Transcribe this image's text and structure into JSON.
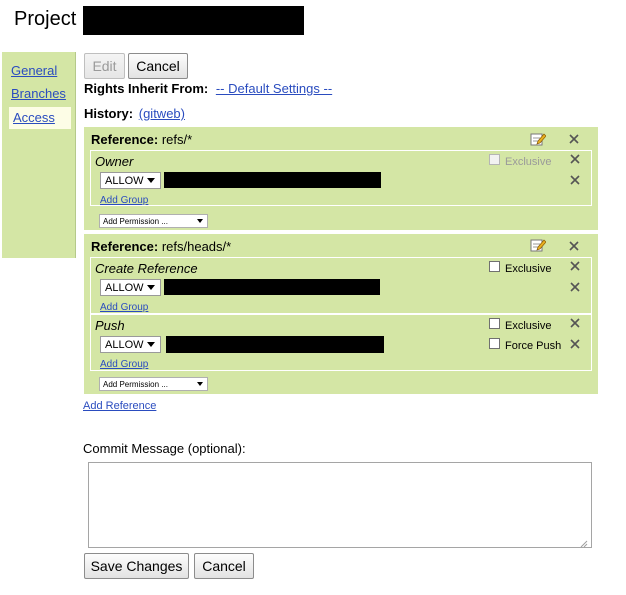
{
  "header": {
    "title": "Project"
  },
  "sidebar": {
    "items": [
      {
        "label": "General"
      },
      {
        "label": "Branches"
      },
      {
        "label": "Access"
      }
    ]
  },
  "toolbar": {
    "edit_label": "Edit",
    "cancel_label": "Cancel"
  },
  "inherit": {
    "label": "Rights Inherit From:",
    "value": "-- Default Settings --"
  },
  "history": {
    "label": "History:",
    "link": "(gitweb)"
  },
  "sections": [
    {
      "ref_label": "Reference:",
      "ref": "refs/*",
      "permissions": [
        {
          "name": "Owner",
          "exclusive_label": "Exclusive",
          "rule_action": "ALLOW",
          "add_group": "Add Group"
        }
      ],
      "add_permission": "Add Permission ..."
    },
    {
      "ref_label": "Reference:",
      "ref": "refs/heads/*",
      "permissions": [
        {
          "name": "Create Reference",
          "exclusive_label": "Exclusive",
          "rule_action": "ALLOW",
          "add_group": "Add Group"
        },
        {
          "name": "Push",
          "exclusive_label": "Exclusive",
          "force_push_label": "Force Push",
          "rule_action": "ALLOW",
          "add_group": "Add Group"
        }
      ],
      "add_permission": "Add Permission ..."
    }
  ],
  "add_reference": "Add Reference",
  "commit": {
    "label": "Commit Message (optional):",
    "value": ""
  },
  "footer": {
    "save_label": "Save Changes",
    "cancel_label": "Cancel"
  },
  "icons": {
    "edit": "edit-icon",
    "remove": "close-icon",
    "dropdown": "chevron-down-icon"
  }
}
